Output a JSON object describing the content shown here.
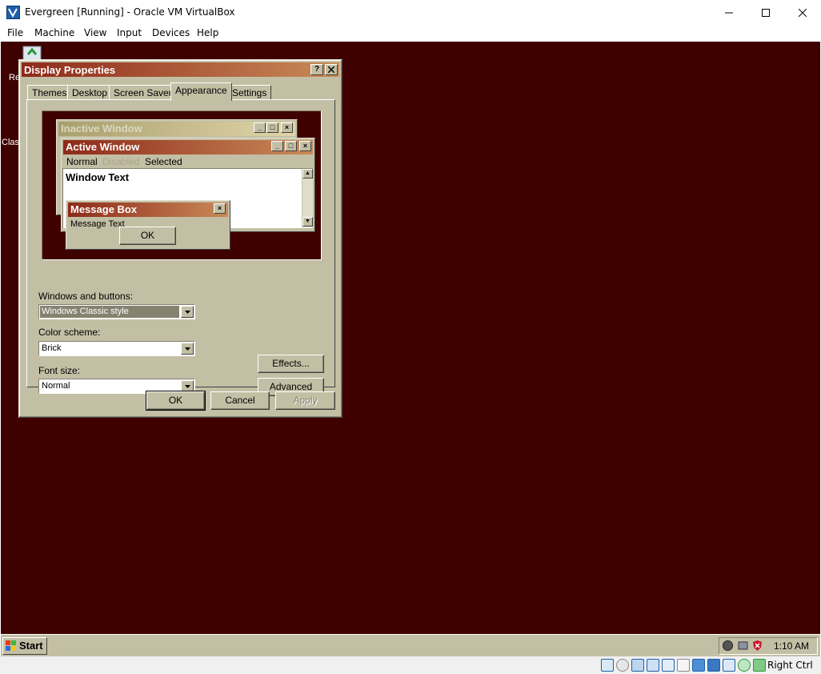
{
  "host": {
    "title": "Evergreen [Running] - Oracle VM VirtualBox",
    "menu": [
      "File",
      "Machine",
      "View",
      "Input",
      "Devices",
      "Help"
    ],
    "host_key": "Right Ctrl"
  },
  "desktop": {
    "background": "#3f0000",
    "icons": [
      {
        "label": "Re",
        "icon": "recycle-bin-icon"
      },
      {
        "label": "Clas",
        "icon": "classic-icon"
      }
    ]
  },
  "dialog": {
    "title": "Display Properties",
    "help_glyph": "?",
    "tabs": [
      "Themes",
      "Desktop",
      "Screen Saver",
      "Appearance",
      "Settings"
    ],
    "active_tab": "Appearance",
    "preview": {
      "inactive_title": "Inactive Window",
      "active_title": "Active Window",
      "menu_normal": "Normal",
      "menu_disabled": "Disabled",
      "menu_selected": "Selected",
      "window_text": "Window Text",
      "msgbox_title": "Message Box",
      "msgbox_text": "Message Text",
      "msgbox_ok": "OK"
    },
    "windows_and_buttons": {
      "label": "Windows and buttons:",
      "value": "Windows Classic style"
    },
    "color_scheme": {
      "label": "Color scheme:",
      "value": "Brick"
    },
    "font_size": {
      "label": "Font size:",
      "value": "Normal"
    },
    "effects_button": "Effects...",
    "advanced_button": "Advanced",
    "ok": "OK",
    "cancel": "Cancel",
    "apply": "Apply"
  },
  "taskbar": {
    "start": "Start",
    "clock": "1:10 AM"
  },
  "colors": {
    "title_active_start": "#8e2a1a",
    "title_active_end": "#c98a58",
    "title_inactive_start": "#a89f6e",
    "title_inactive_end": "#e0d5a8",
    "face": "#c3bfa5"
  }
}
